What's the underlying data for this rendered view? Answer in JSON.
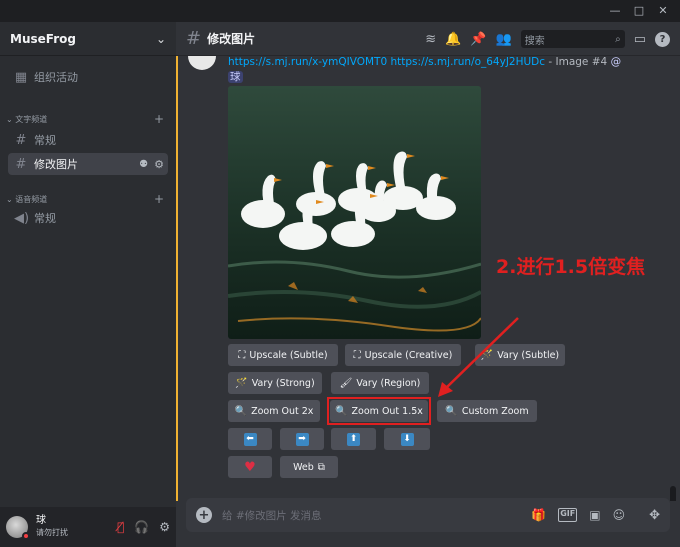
{
  "window": {
    "minimize": "—",
    "maximize": "□",
    "close": "✕"
  },
  "sidebar": {
    "server_name": "MuseFrog",
    "events_label": "组织活动",
    "text_category": "文字频道",
    "text_channels": [
      {
        "label": "常规"
      },
      {
        "label": "修改图片"
      }
    ],
    "voice_category": "语音频道",
    "voice_channels": [
      {
        "label": "常规"
      }
    ]
  },
  "user": {
    "name": "球",
    "status": "请勿打扰"
  },
  "header": {
    "channel": "修改图片",
    "search_placeholder": "搜索"
  },
  "message": {
    "link1": "https://s.mj.run/x-ymQIVOMT0",
    "link2": "https://s.mj.run/o_64yJ2HUDc",
    "suffix": " - Image #4 ",
    "mention_at": "@",
    "mention_user": "球"
  },
  "buttons": {
    "upscale_subtle": "Upscale (Subtle)",
    "upscale_creative": "Upscale (Creative)",
    "vary_subtle": "Vary (Subtle)",
    "vary_strong": "Vary (Strong)",
    "vary_region": "Vary (Region)",
    "zoom_2x": "Zoom Out 2x",
    "zoom_15x": "Zoom Out 1.5x",
    "custom_zoom": "Custom Zoom",
    "web": "Web"
  },
  "annotation": "2.进行1.5倍变焦",
  "composer": {
    "placeholder": "给 #修改图片 发消息"
  },
  "colors": {
    "accent": "#f0b232",
    "annotation": "#e02020",
    "link": "#00a8fc"
  }
}
